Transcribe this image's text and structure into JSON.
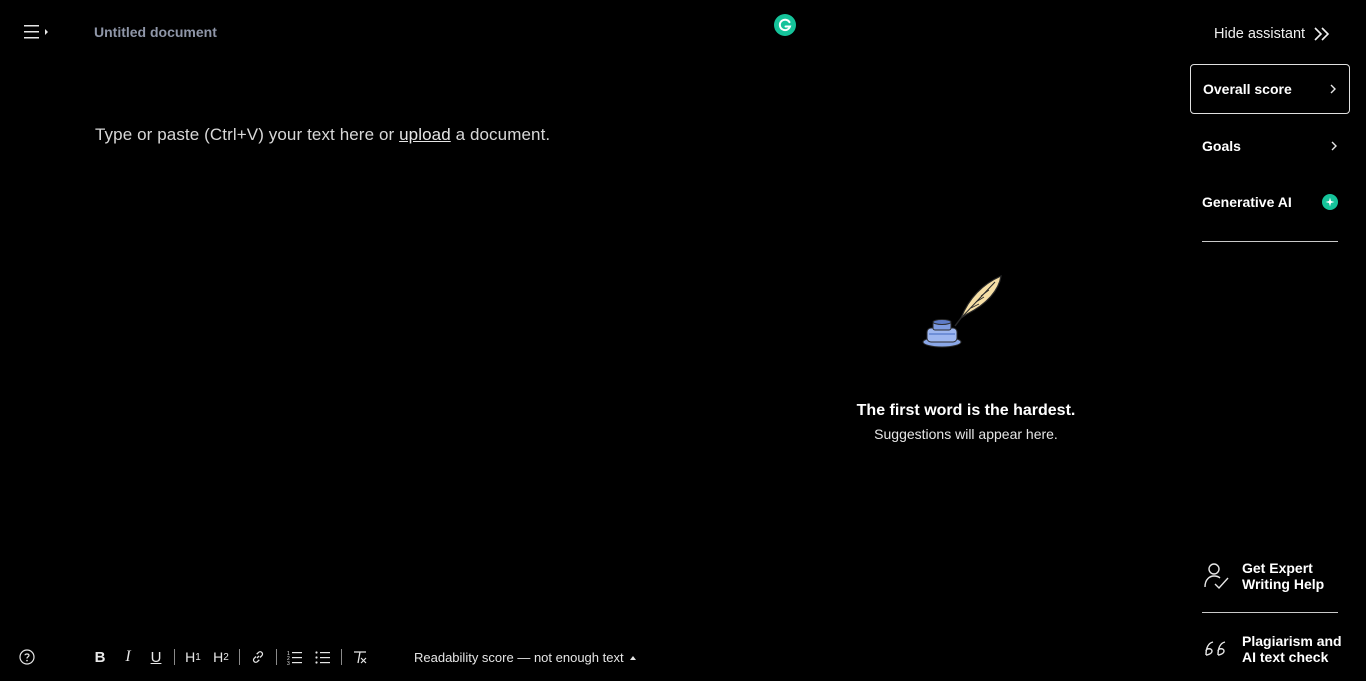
{
  "header": {
    "document_title": "Untitled document"
  },
  "editor": {
    "placeholder_before": "Type or paste (Ctrl+V) your text here or ",
    "upload_link": "upload",
    "placeholder_after": " a document."
  },
  "assistant": {
    "hide_label": "Hide assistant",
    "cards": {
      "overall_score": "Overall score",
      "goals": "Goals",
      "generative_ai": "Generative AI"
    },
    "empty_state": {
      "title": "The first word is the hardest.",
      "subtitle": "Suggestions will appear here."
    },
    "expert_help": {
      "line1": "Get Expert",
      "line2": "Writing Help"
    },
    "plagiarism": {
      "line1": "Plagiarism and",
      "line2": "AI text check"
    }
  },
  "toolbar": {
    "bold": "B",
    "italic": "I",
    "underline": "U",
    "h1": "H",
    "h1_sub": "1",
    "h2": "H",
    "h2_sub": "2",
    "readability": "Readability score — not enough text"
  },
  "colors": {
    "background": "#000000",
    "brand": "#15c39a",
    "muted_title": "#8f96a8"
  }
}
